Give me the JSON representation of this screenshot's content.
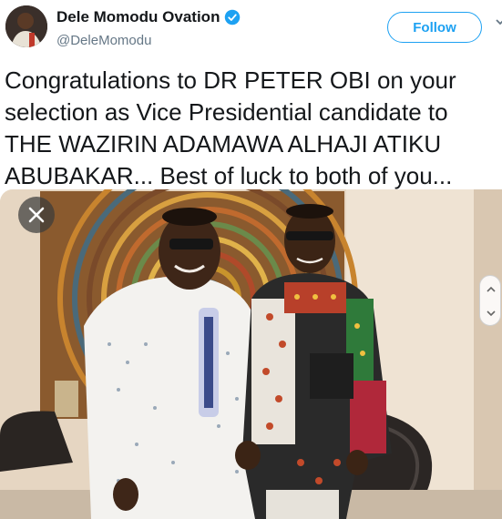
{
  "tweet": {
    "display_name": "Dele Momodu Ovation",
    "handle": "@DeleMomodu",
    "verified": true,
    "follow_label": "Follow",
    "text_lines": [
      "Congratulations to DR PETER OBI on your",
      "selection as Vice Presidential candidate to",
      "THE WAZIRIN ADAMAWA ALHAJI ATIKU",
      "ABUBAKAR... Best of luck to both of you..."
    ]
  },
  "icons": {
    "verified": "verified-badge-icon",
    "caret": "chevron-down-icon",
    "close": "close-icon",
    "scroll_up": "chevron-up-icon",
    "scroll_down": "chevron-down-icon"
  },
  "colors": {
    "accent": "#1da1f2",
    "text": "#14171a",
    "secondary_text": "#657786"
  }
}
